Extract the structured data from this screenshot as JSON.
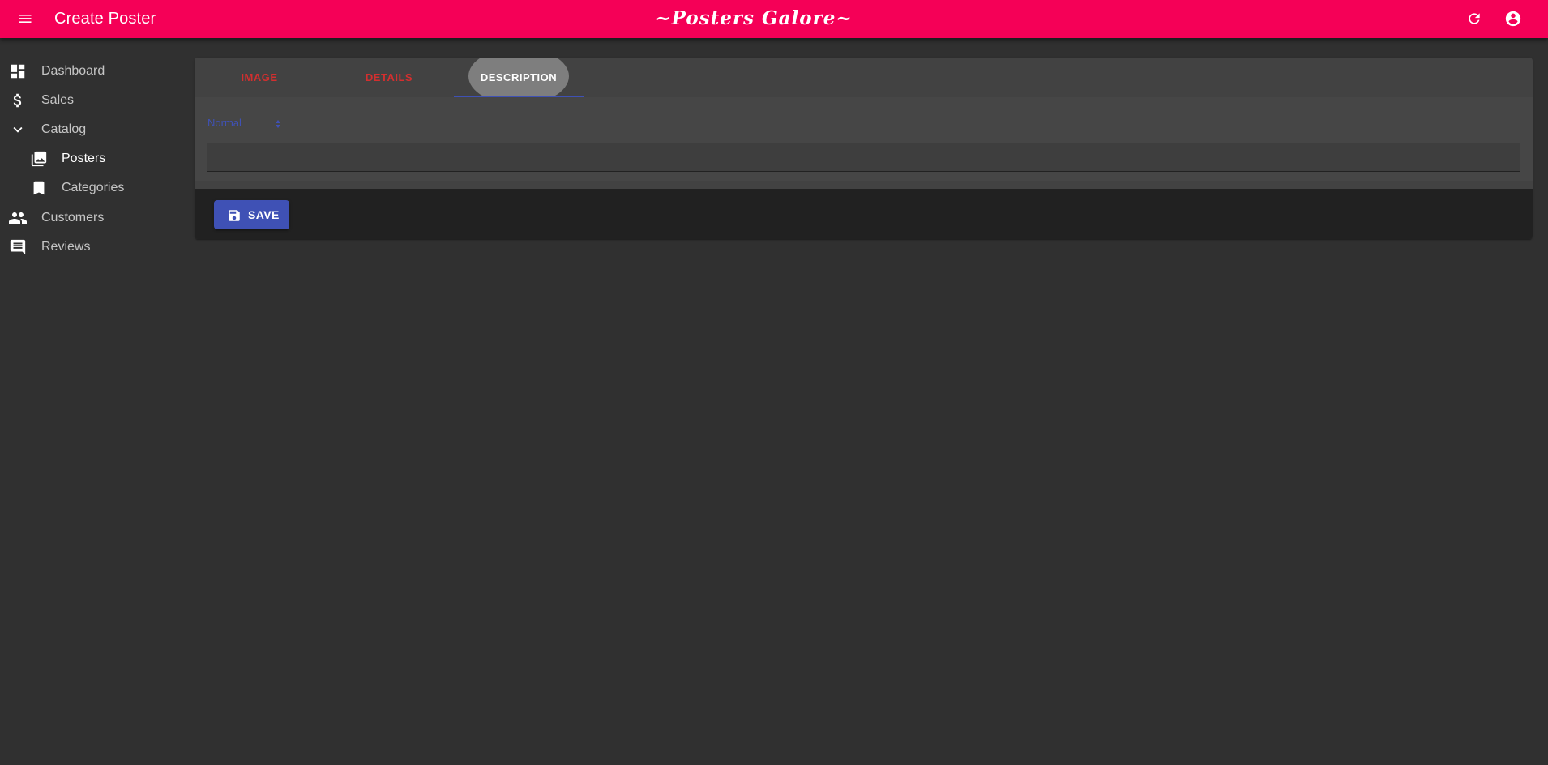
{
  "appbar": {
    "title": "Create Poster",
    "brand": "~Posters Galore~",
    "icons": [
      "menu-icon",
      "refresh-icon",
      "account-icon"
    ]
  },
  "sidebar": {
    "items": [
      {
        "label": "Dashboard",
        "icon": "dashboard-icon"
      },
      {
        "label": "Sales",
        "icon": "dollar-icon"
      },
      {
        "label": "Catalog",
        "icon": "chevron-down-icon"
      },
      {
        "label": "Posters",
        "icon": "collections-icon",
        "active": true
      },
      {
        "label": "Categories",
        "icon": "bookmark-icon"
      },
      {
        "label": "Customers",
        "icon": "people-icon"
      },
      {
        "label": "Reviews",
        "icon": "comment-icon"
      }
    ]
  },
  "form": {
    "tabs": [
      {
        "label": "Image"
      },
      {
        "label": "Details"
      },
      {
        "label": "Description",
        "active": true
      }
    ],
    "editor": {
      "header_select": "Normal",
      "content": ""
    },
    "save_label": "Save"
  },
  "colors": {
    "appbar": "#f50057",
    "primary": "#3f51b5",
    "tab_error": "#d32f2f",
    "background": "#303030",
    "card": "#424242"
  }
}
